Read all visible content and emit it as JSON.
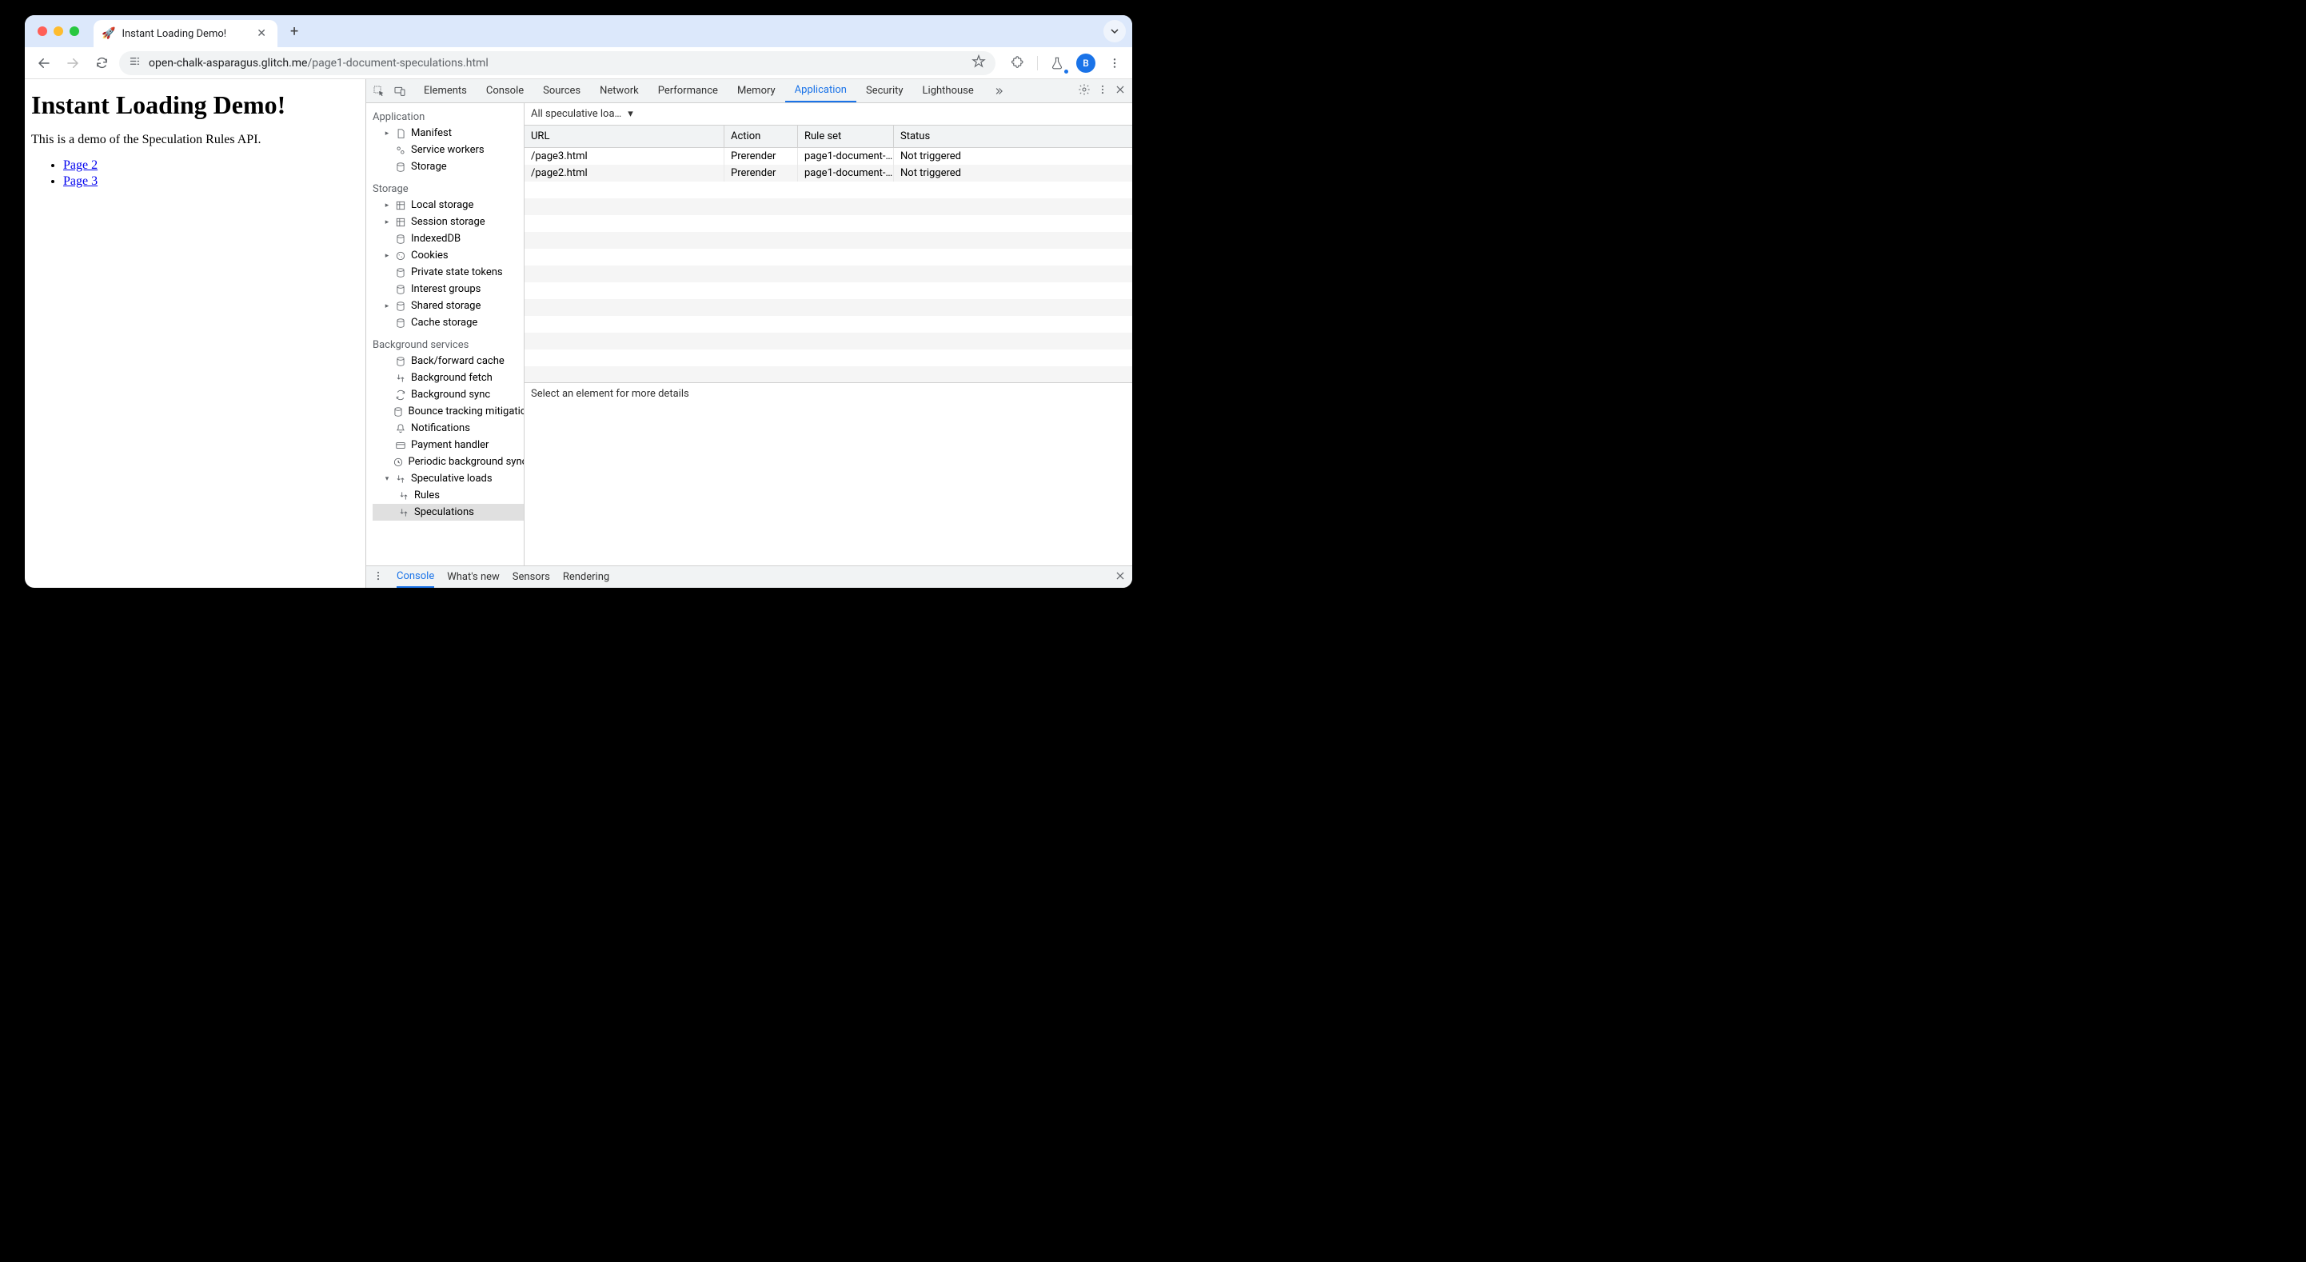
{
  "tab": {
    "favicon": "🚀",
    "title": "Instant Loading Demo!"
  },
  "address": {
    "host": "open-chalk-asparagus.glitch.me",
    "path": "/page1-document-speculations.html"
  },
  "avatar_letter": "B",
  "page": {
    "heading": "Instant Loading Demo!",
    "paragraph": "This is a demo of the Speculation Rules API.",
    "links": [
      {
        "label": "Page 2"
      },
      {
        "label": "Page 3"
      }
    ]
  },
  "devtools": {
    "tabs": [
      "Elements",
      "Console",
      "Sources",
      "Network",
      "Performance",
      "Memory",
      "Application",
      "Security",
      "Lighthouse"
    ],
    "active_tab": "Application",
    "sidebar": {
      "section1": {
        "title": "Application",
        "items": [
          "Manifest",
          "Service workers",
          "Storage"
        ]
      },
      "section2": {
        "title": "Storage",
        "items": [
          "Local storage",
          "Session storage",
          "IndexedDB",
          "Cookies",
          "Private state tokens",
          "Interest groups",
          "Shared storage",
          "Cache storage"
        ]
      },
      "section3": {
        "title": "Background services",
        "items": [
          "Back/forward cache",
          "Background fetch",
          "Background sync",
          "Bounce tracking mitigation",
          "Notifications",
          "Payment handler",
          "Periodic background sync",
          "Speculative loads"
        ],
        "children": [
          "Rules",
          "Speculations"
        ]
      }
    },
    "filter_dropdown": "All speculative loa…",
    "table": {
      "headers": [
        "URL",
        "Action",
        "Rule set",
        "Status"
      ],
      "rows": [
        {
          "url": "/page3.html",
          "action": "Prerender",
          "ruleset": "page1-document-…",
          "status": "Not triggered"
        },
        {
          "url": "/page2.html",
          "action": "Prerender",
          "ruleset": "page1-document-…",
          "status": "Not triggered"
        }
      ]
    },
    "detail_placeholder": "Select an element for more details",
    "drawer_tabs": [
      "Console",
      "What's new",
      "Sensors",
      "Rendering"
    ],
    "drawer_active": "Console"
  }
}
